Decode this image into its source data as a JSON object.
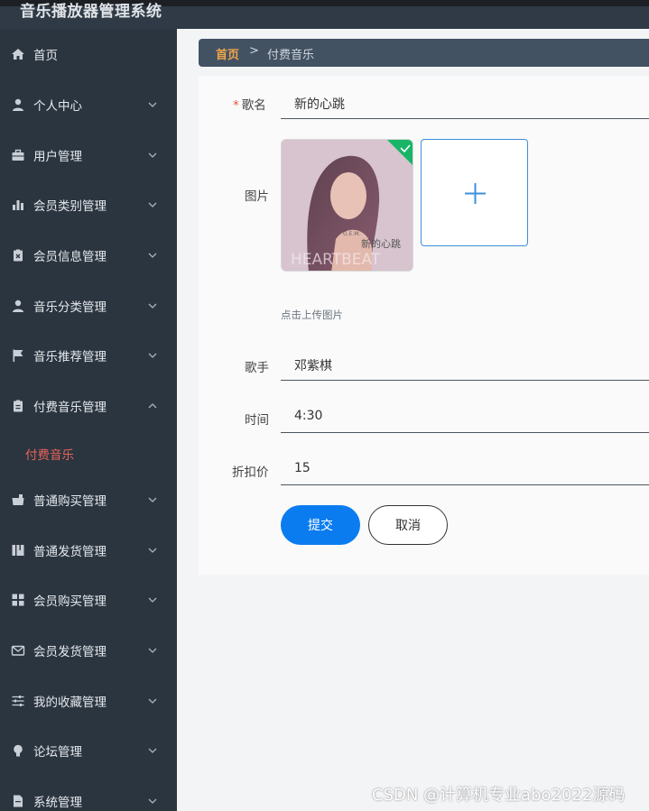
{
  "app": {
    "title": "音乐播放器管理系统"
  },
  "sidebar": {
    "items": [
      {
        "label": "首页",
        "icon": "home-icon",
        "expandable": false
      },
      {
        "label": "个人中心",
        "icon": "user-icon",
        "expandable": true
      },
      {
        "label": "用户管理",
        "icon": "briefcase-icon",
        "expandable": true
      },
      {
        "label": "会员类别管理",
        "icon": "bar-chart-icon",
        "expandable": true
      },
      {
        "label": "会员信息管理",
        "icon": "clipboard-x-icon",
        "expandable": true
      },
      {
        "label": "音乐分类管理",
        "icon": "user-icon",
        "expandable": true
      },
      {
        "label": "音乐推荐管理",
        "icon": "flag-icon",
        "expandable": true
      },
      {
        "label": "付费音乐管理",
        "icon": "clipboard-icon",
        "expandable": true,
        "expanded": true
      },
      {
        "label": "普通购买管理",
        "icon": "cart-icon",
        "expandable": true
      },
      {
        "label": "普通发货管理",
        "icon": "book-icon",
        "expandable": true
      },
      {
        "label": "会员购买管理",
        "icon": "grid-icon",
        "expandable": true
      },
      {
        "label": "会员发货管理",
        "icon": "mail-icon",
        "expandable": true
      },
      {
        "label": "我的收藏管理",
        "icon": "sliders-icon",
        "expandable": true
      },
      {
        "label": "论坛管理",
        "icon": "bulb-icon",
        "expandable": true
      },
      {
        "label": "系统管理",
        "icon": "file-icon",
        "expandable": true
      }
    ],
    "active_submenu": "付费音乐"
  },
  "breadcrumb": {
    "home": "首页",
    "separator": ">",
    "current": "付费音乐"
  },
  "form": {
    "song_name": {
      "label": "歌名",
      "value": "新的心跳",
      "required": true
    },
    "image": {
      "label": "图片",
      "upload_hint": "点击上传图片",
      "thumb_caption": "新的心跳",
      "thumb_bg_text": "HEARTBEAT",
      "thumb_small_text": "G.E.M."
    },
    "singer": {
      "label": "歌手",
      "value": "邓紫棋"
    },
    "duration": {
      "label": "时间",
      "value": "4:30"
    },
    "discount_price": {
      "label": "折扣价",
      "value": "15"
    },
    "submit_label": "提交",
    "cancel_label": "取消"
  },
  "colors": {
    "sidebar_bg": "#2b3540",
    "accent_active": "#e8635a",
    "primary_button": "#0b7cf0",
    "breadcrumb_home": "#f0a64a"
  },
  "watermark": "CSDN @计算机专业abo2022源码"
}
